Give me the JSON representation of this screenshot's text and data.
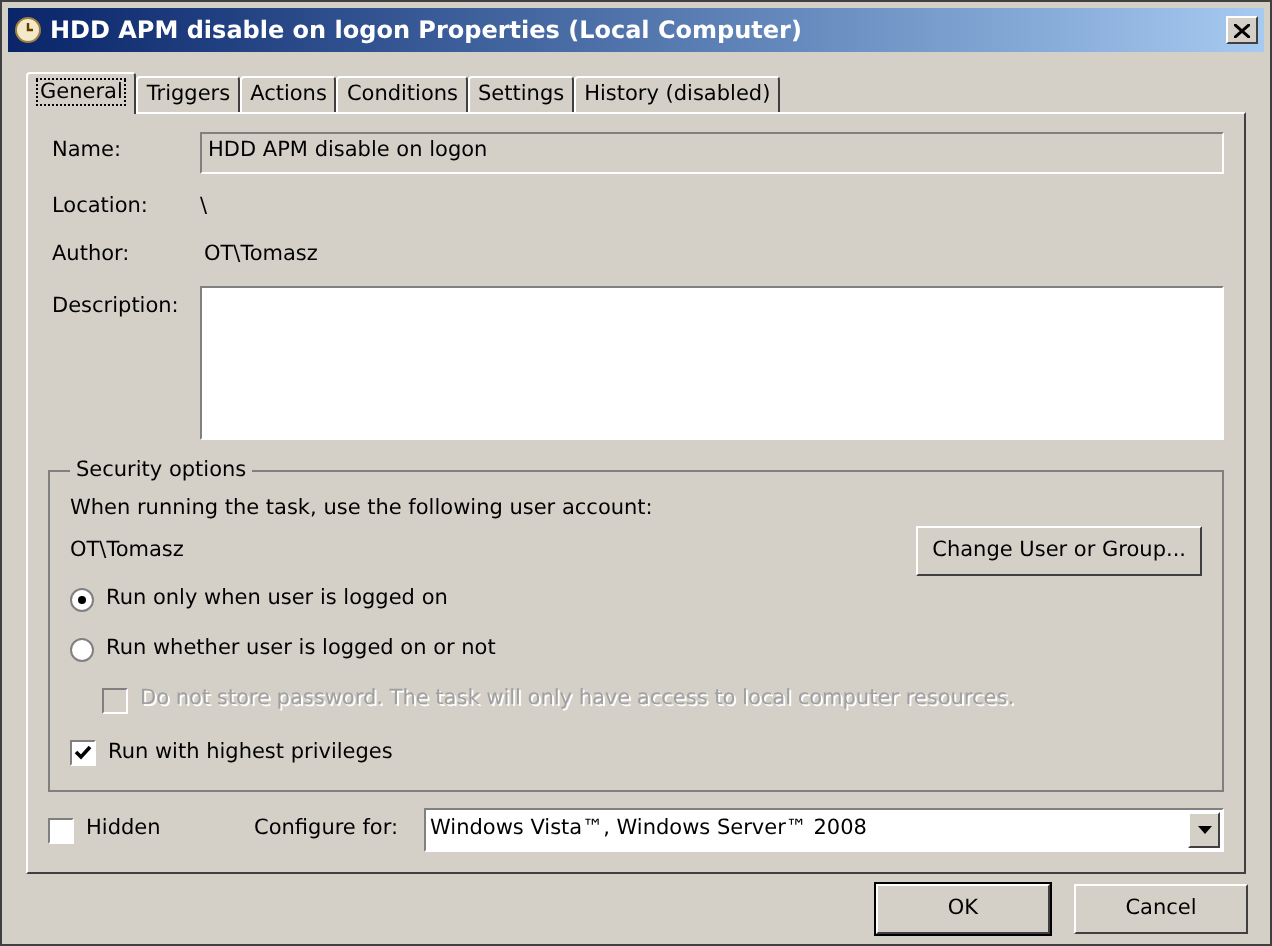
{
  "window": {
    "title": "HDD APM disable on logon Properties (Local Computer)"
  },
  "tabs": [
    {
      "label": "General",
      "selected": true
    },
    {
      "label": "Triggers",
      "selected": false
    },
    {
      "label": "Actions",
      "selected": false
    },
    {
      "label": "Conditions",
      "selected": false
    },
    {
      "label": "Settings",
      "selected": false
    },
    {
      "label": "History (disabled)",
      "selected": false
    }
  ],
  "fields": {
    "name_label": "Name:",
    "name_value": "HDD APM disable on logon",
    "location_label": "Location:",
    "location_value": "\\",
    "author_label": "Author:",
    "author_value": "OT\\Tomasz",
    "description_label": "Description:"
  },
  "security": {
    "title": "Security options",
    "account_prompt": "When running the task, use the following user account:",
    "account": "OT\\Tomasz",
    "change_button": "Change User or Group...",
    "options": [
      {
        "kind": "radio",
        "label": "Run only when user is logged on",
        "selected": true,
        "disabled": false
      },
      {
        "kind": "radio",
        "label": "Run whether user is logged on or not",
        "selected": false,
        "disabled": false,
        "children": [
          {
            "kind": "checkbox",
            "label": "Do not store password.  The task will only have access to local computer resources.",
            "checked": false,
            "disabled": true
          }
        ]
      },
      {
        "kind": "checkbox",
        "label": "Run with highest privileges",
        "checked": true,
        "disabled": false
      }
    ]
  },
  "hidden": {
    "label": "Hidden",
    "checked": false
  },
  "configure": {
    "label": "Configure for:",
    "value": "Windows Vista™, Windows Server™ 2008"
  },
  "buttons": [
    {
      "label": "OK",
      "default": true
    },
    {
      "label": "Cancel",
      "default": false
    }
  ]
}
